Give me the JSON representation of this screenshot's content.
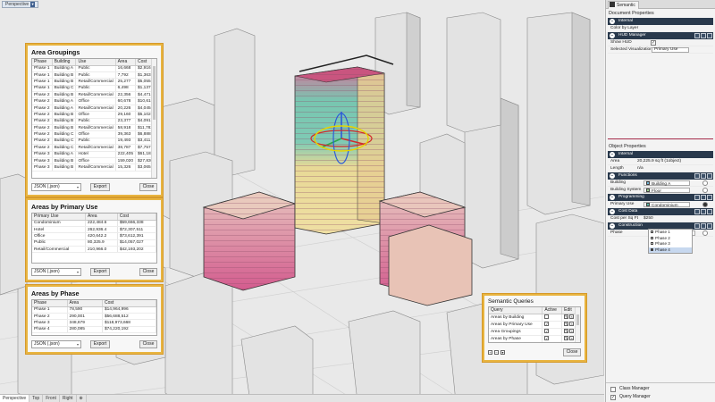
{
  "viewport": {
    "tab_label": "Perspective",
    "bottom_tabs": [
      "Perspective",
      "Top",
      "Front",
      "Right"
    ],
    "add_tab": "⊕"
  },
  "area_groupings": {
    "title": "Area Groupings",
    "columns": [
      "Phase",
      "Building",
      "Use",
      "Area",
      "Cost"
    ],
    "rows": [
      [
        "Phase 1",
        "Building A",
        "Public",
        "16,668",
        "$2,916,811"
      ],
      [
        "Phase 1",
        "Building B",
        "Public",
        "7,792",
        "$1,363,663"
      ],
      [
        "Phase 1",
        "Building B",
        "Retail/Commercial",
        "25,277",
        "$5,055,383"
      ],
      [
        "Phase 1",
        "Building C",
        "Public",
        "6,498",
        "$1,137,064"
      ],
      [
        "Phase 2",
        "Building B",
        "Retail/Commercial",
        "22,356",
        "$4,471,136"
      ],
      [
        "Phase 2",
        "Building A",
        "Office",
        "60,678",
        "$10,618,585"
      ],
      [
        "Phase 2",
        "Building A",
        "Retail/Commercial",
        "20,226",
        "$4,045,173"
      ],
      [
        "Phase 2",
        "Building B",
        "Office",
        "29,160",
        "$5,102,960"
      ],
      [
        "Phase 2",
        "Building B",
        "Public",
        "23,377",
        "$4,091,029"
      ],
      [
        "Phase 2",
        "Building B",
        "Retail/Commercial",
        "58,918",
        "$11,783,566"
      ],
      [
        "Phase 2",
        "Building C",
        "Office",
        "39,363",
        "$6,888,541"
      ],
      [
        "Phase 2",
        "Building C",
        "Public",
        "19,493",
        "$3,411,320"
      ],
      [
        "Phase 2",
        "Building C",
        "Retail/Commercial",
        "38,787",
        "$7,757,303"
      ],
      [
        "Phase 3",
        "Building A",
        "Hotel",
        "222,405",
        "$61,183,278"
      ],
      [
        "Phase 3",
        "Building B",
        "Office",
        "159,020",
        "$27,830,225"
      ],
      [
        "Phase 3",
        "Building B",
        "Retail/Commercial",
        "15,326",
        "$3,065,217"
      ]
    ],
    "format": "JSON (.json)",
    "export_label": "Export",
    "close_label": "Close"
  },
  "areas_by_use": {
    "title": "Areas by Primary Use",
    "columns": [
      "Primary Use",
      "Area",
      "Cost"
    ],
    "rows": [
      [
        "Condominium",
        "222,484.6",
        "$59,666,338"
      ],
      [
        "Hotel",
        "262,936.4",
        "$72,307,511"
      ],
      [
        "Office",
        "420,642.2",
        "$73,612,391"
      ],
      [
        "Public",
        "80,325.9",
        "$14,057,027"
      ],
      [
        "Retail/Commercial",
        "210,966.0",
        "$42,193,202"
      ]
    ],
    "format": "JSON (.json)",
    "export_label": "Export",
    "close_label": "Close"
  },
  "areas_by_phase": {
    "title": "Areas by Phase",
    "columns": [
      "Phase",
      "Area",
      "Cost"
    ],
    "rows": [
      [
        "Phase 1",
        "78,590",
        "$14,964,996"
      ],
      [
        "Phase 2",
        "290,001",
        "$56,688,512"
      ],
      [
        "Phase 3",
        "348,679",
        "$118,973,668"
      ],
      [
        "Phase 4",
        "280,085",
        "$74,220,192"
      ]
    ],
    "format": "JSON (.json)",
    "export_label": "Export",
    "close_label": "Close"
  },
  "semantic_queries": {
    "title": "Semantic Queries",
    "columns": [
      "Query",
      "Active",
      "Edit"
    ],
    "rows": [
      {
        "name": "Areas by Building",
        "active": false
      },
      {
        "name": "Areas by Primary Use",
        "active": true
      },
      {
        "name": "Area Groupings",
        "active": true
      },
      {
        "name": "Areas by Phase",
        "active": true
      }
    ],
    "close_label": "Close"
  },
  "right_panel": {
    "tab_label": "Semantic",
    "document_properties": "Document Properties",
    "internal": {
      "title": "Internal",
      "color_by_layer": "Color by Layer"
    },
    "hud": {
      "title": "HUD Manager",
      "show_hud_label": "Show HUD",
      "show_hud": true,
      "visualization_label": "Selected Visualization",
      "visualization_value": "Primary Use"
    },
    "object_properties": "Object Properties",
    "obj_internal": {
      "title": "Internal",
      "area_label": "Area",
      "area_value": "20,225.9 sq ft (1object)",
      "length_label": "Length",
      "length_value": "n/a"
    },
    "functions": {
      "title": "Functions",
      "building_label": "Building",
      "building_value": "Building A",
      "system_label": "Building System",
      "system_value": "Floor"
    },
    "programming": {
      "title": "Programming",
      "use_label": "Primary Use",
      "use_value": "Condominium"
    },
    "cost": {
      "title": "Cost Data",
      "label": "Cost per Sq Ft",
      "value": "$250"
    },
    "construction": {
      "title": "Construction",
      "phase_label": "Phase",
      "phase_value": "Phase 4",
      "options": [
        "Phase 1",
        "Phase 2",
        "Phase 3",
        "Phase 4"
      ]
    },
    "class_manager": "Class Manager",
    "query_manager": "Query Manager",
    "query_manager_checked": true
  },
  "colors": {
    "accent_border": "#e8b440",
    "group_header": "#29394c",
    "selection": "#c7d8ef",
    "hud_highlight": "#d64f7a"
  }
}
